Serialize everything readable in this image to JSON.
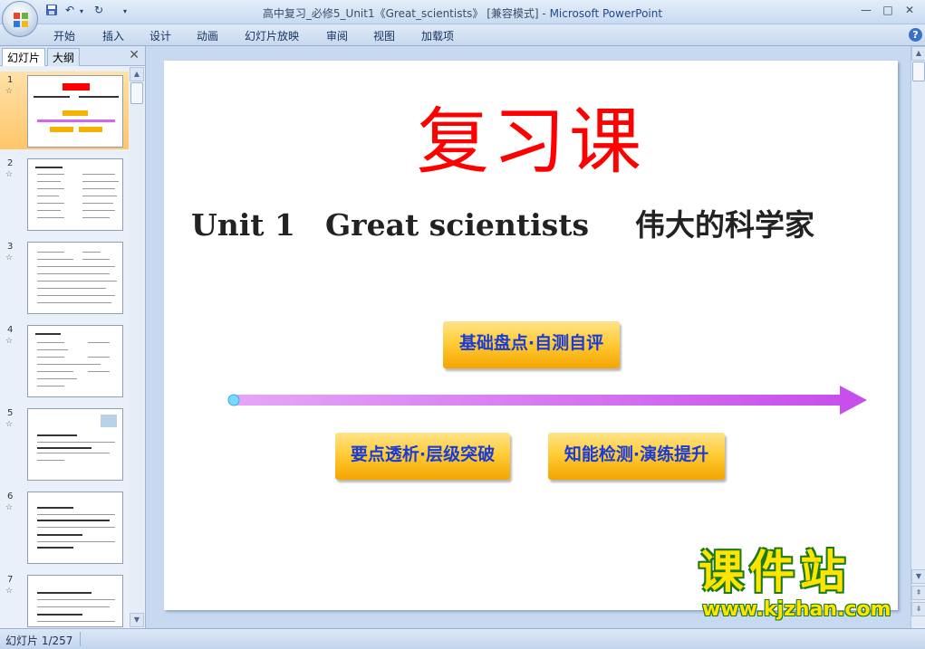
{
  "window": {
    "title": "高中复习_必修5_Unit1《Great_scientists》 [兼容模式] - Microsoft PowerPoint",
    "title_doc": "高中复习_必修5_Unit1《Great_scientists》 [兼容模式] - ",
    "title_app": "Microsoft PowerPoint",
    "minimize": "—",
    "maximize": "□",
    "close": "✕"
  },
  "quick_access": {
    "save_icon": "save-icon",
    "undo_icon": "undo-icon",
    "redo_icon": "redo-icon"
  },
  "ribbon": {
    "tabs": [
      "开始",
      "插入",
      "设计",
      "动画",
      "幻灯片放映",
      "审阅",
      "视图",
      "加载项"
    ],
    "help": "?"
  },
  "left_panel": {
    "tabs": [
      "幻灯片",
      "大纲"
    ],
    "close": "✕",
    "thumbnails": [
      "1",
      "2",
      "3",
      "4",
      "5",
      "6",
      "7"
    ],
    "selected": 1,
    "star": "☆"
  },
  "slide": {
    "title": "复习课",
    "subtitle_en": "Unit 1　Great scientists",
    "subtitle_cn": "伟大的科学家",
    "buttons": [
      "基础盘点·自测自评",
      "要点透析·层级突破",
      "知能检测·演练提升"
    ]
  },
  "watermark": {
    "main": "课件站",
    "url": "www.kjzhan.com"
  },
  "status": {
    "slide_info": "幻灯片 1/257"
  },
  "colors": {
    "title_red": "#ff0000",
    "arrow_violet": "#d264f0",
    "pill_gold": "#ffcd38",
    "pill_text": "#1a3bd6"
  }
}
